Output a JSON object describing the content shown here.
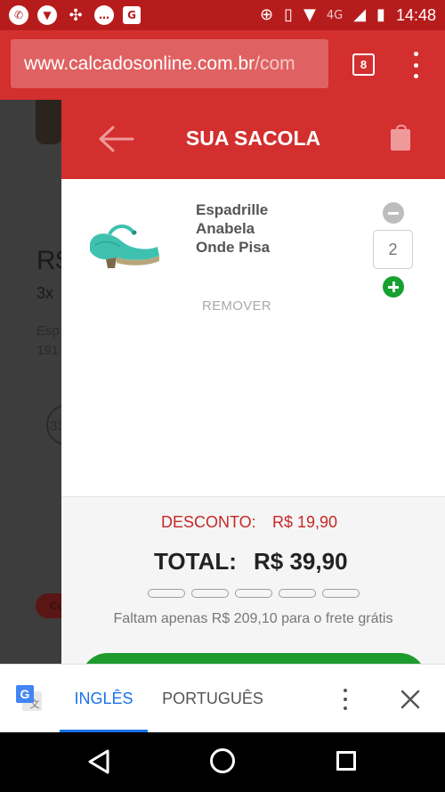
{
  "status_bar": {
    "network": "4G",
    "time": "14:48"
  },
  "browser": {
    "url_main": "www.calcadosonline.com.br",
    "url_rest": "/com",
    "tab_count": "8"
  },
  "background_page": {
    "price_fragment": "R$",
    "installments_fragment": "3x",
    "desc_fragment_1": "Esp",
    "desc_fragment_2": "191",
    "size_fragment": "33",
    "button_fragment": "Co"
  },
  "cart": {
    "title": "SUA SACOLA",
    "item": {
      "name_line1": "Espadrille",
      "name_line2": "Anabela",
      "name_line3": "Onde Pisa",
      "quantity": "2",
      "remove_label": "REMOVER",
      "shoe_color": "#3fc1b0"
    },
    "discount_label": "DESCONTO:",
    "discount_value": "R$ 19,90",
    "total_label": "TOTAL:",
    "total_value": "R$ 39,90",
    "shipping_message": "Faltam apenas R$ 209,10 para o frete grátis",
    "shipping_progress_steps": 5,
    "shipping_progress_filled": 0
  },
  "translate_bar": {
    "tab_source": "INGLÊS",
    "tab_target": "PORTUGUÊS"
  },
  "colors": {
    "brand_red": "#d32f2f",
    "status_red": "#b71c1c",
    "checkout_green": "#1e9b2d",
    "translate_blue": "#1a73e8"
  }
}
